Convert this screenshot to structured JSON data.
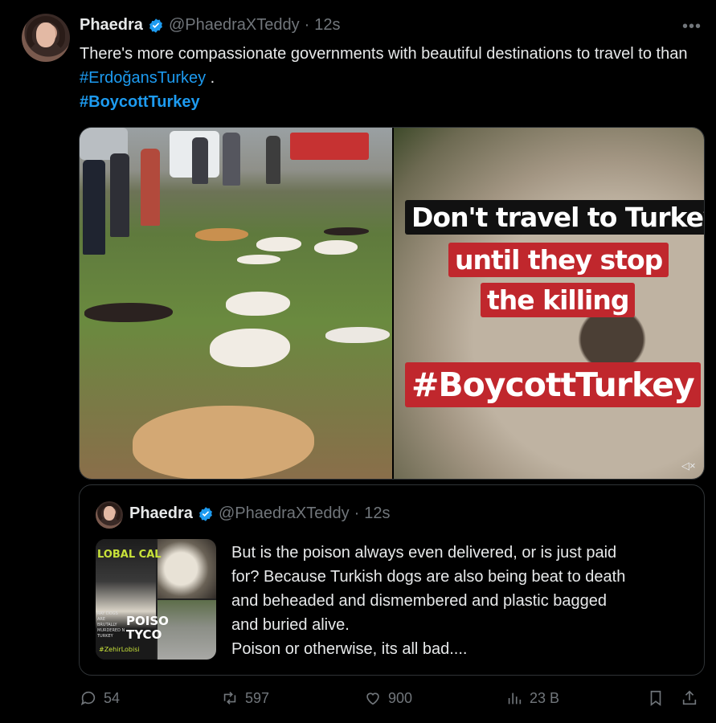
{
  "tweet": {
    "author_name": "Phaedra",
    "handle": "@PhaedraXTeddy",
    "separator": "·",
    "time": "12s",
    "more_label": "•••",
    "text_part1": "There's more compassionate governments with beautiful destinations to travel to than ",
    "hashtag1": "#ErdoğansTurkey",
    "text_part2": " .",
    "hashtag2": "#BoycottTurkey"
  },
  "media_overlay": {
    "line1": "Don't travel to Turkey",
    "line2": "until they stop",
    "line3": "the killing",
    "line4": "#BoycottTurkey",
    "mute_label": "◁×"
  },
  "quote": {
    "author_name": "Phaedra",
    "handle": "@PhaedraXTeddy",
    "separator": "·",
    "time": "12s",
    "thumb_text_top": "LOBAL CAL",
    "thumb_text_poison": "POISO\nTYCO",
    "thumb_text_small": "RAY DOGS ARE BRUTALLY MURDERED N TURKEY",
    "thumb_text_hash": "#ZehirLobisi",
    "text_lines": [
      "But is the poison always even delivered, or is just paid",
      "for?  Because Turkish dogs are also being beat to death",
      "and beheaded and dismembered and plastic bagged",
      "and buried alive.",
      "Poison or otherwise, its all bad...."
    ]
  },
  "actions": {
    "replies": "54",
    "reposts": "597",
    "likes": "900",
    "views": "23 B"
  },
  "colors": {
    "background": "#000000",
    "text": "#e7e9ea",
    "muted": "#71767b",
    "link": "#1d9bf0",
    "verified": "#1d9bf0",
    "overlay_red": "#c0272d",
    "border": "#2f3336"
  }
}
